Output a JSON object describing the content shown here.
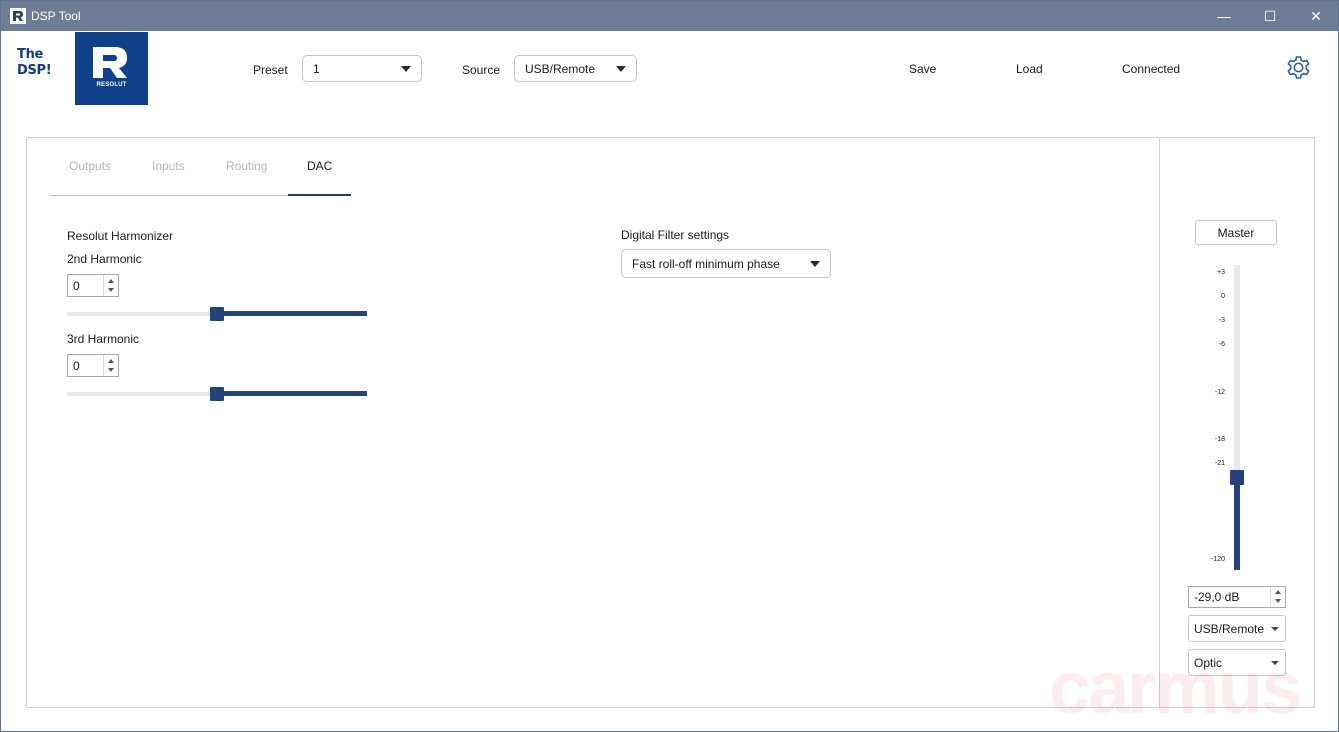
{
  "window": {
    "title": "DSP Tool",
    "controls": {
      "minimize": "—",
      "maximize": "☐",
      "close": "✕"
    }
  },
  "brand": {
    "product_line1": "The",
    "product_line2": "DSP!",
    "logo_text": "RESOLUT",
    "logo_color": "#0f4189"
  },
  "header": {
    "preset_label": "Preset",
    "preset_value": "1",
    "source_label": "Source",
    "source_value": "USB/Remote",
    "save_label": "Save",
    "load_label": "Load",
    "status_text": "Connected",
    "settings_icon": "gear-icon"
  },
  "tabs": [
    {
      "label": "Outputs",
      "active": false
    },
    {
      "label": "Inputs",
      "active": false
    },
    {
      "label": "Routing",
      "active": false
    },
    {
      "label": "DAC",
      "active": true
    }
  ],
  "harmonizer": {
    "title": "Resolut Harmonizer",
    "second": {
      "label": "2nd Harmonic",
      "value": "0",
      "slider_fraction": 0.5
    },
    "third": {
      "label": "3rd Harmonic",
      "value": "0",
      "slider_fraction": 0.5
    }
  },
  "digital_filter": {
    "label": "Digital Filter settings",
    "selected": "Fast roll-off minimum phase"
  },
  "master": {
    "button_label": "Master",
    "scale_ticks": [
      "+3",
      "0",
      "-3",
      "-6",
      "-12",
      "-18",
      "-21",
      "-120"
    ],
    "volume_text": "-29,0 dB",
    "volume_db": -29.0,
    "source_select": "USB/Remote",
    "input_select": "Optic"
  },
  "colors": {
    "accent": "#25437a",
    "titlebar": "#6c7d95"
  },
  "watermark": "carmus"
}
